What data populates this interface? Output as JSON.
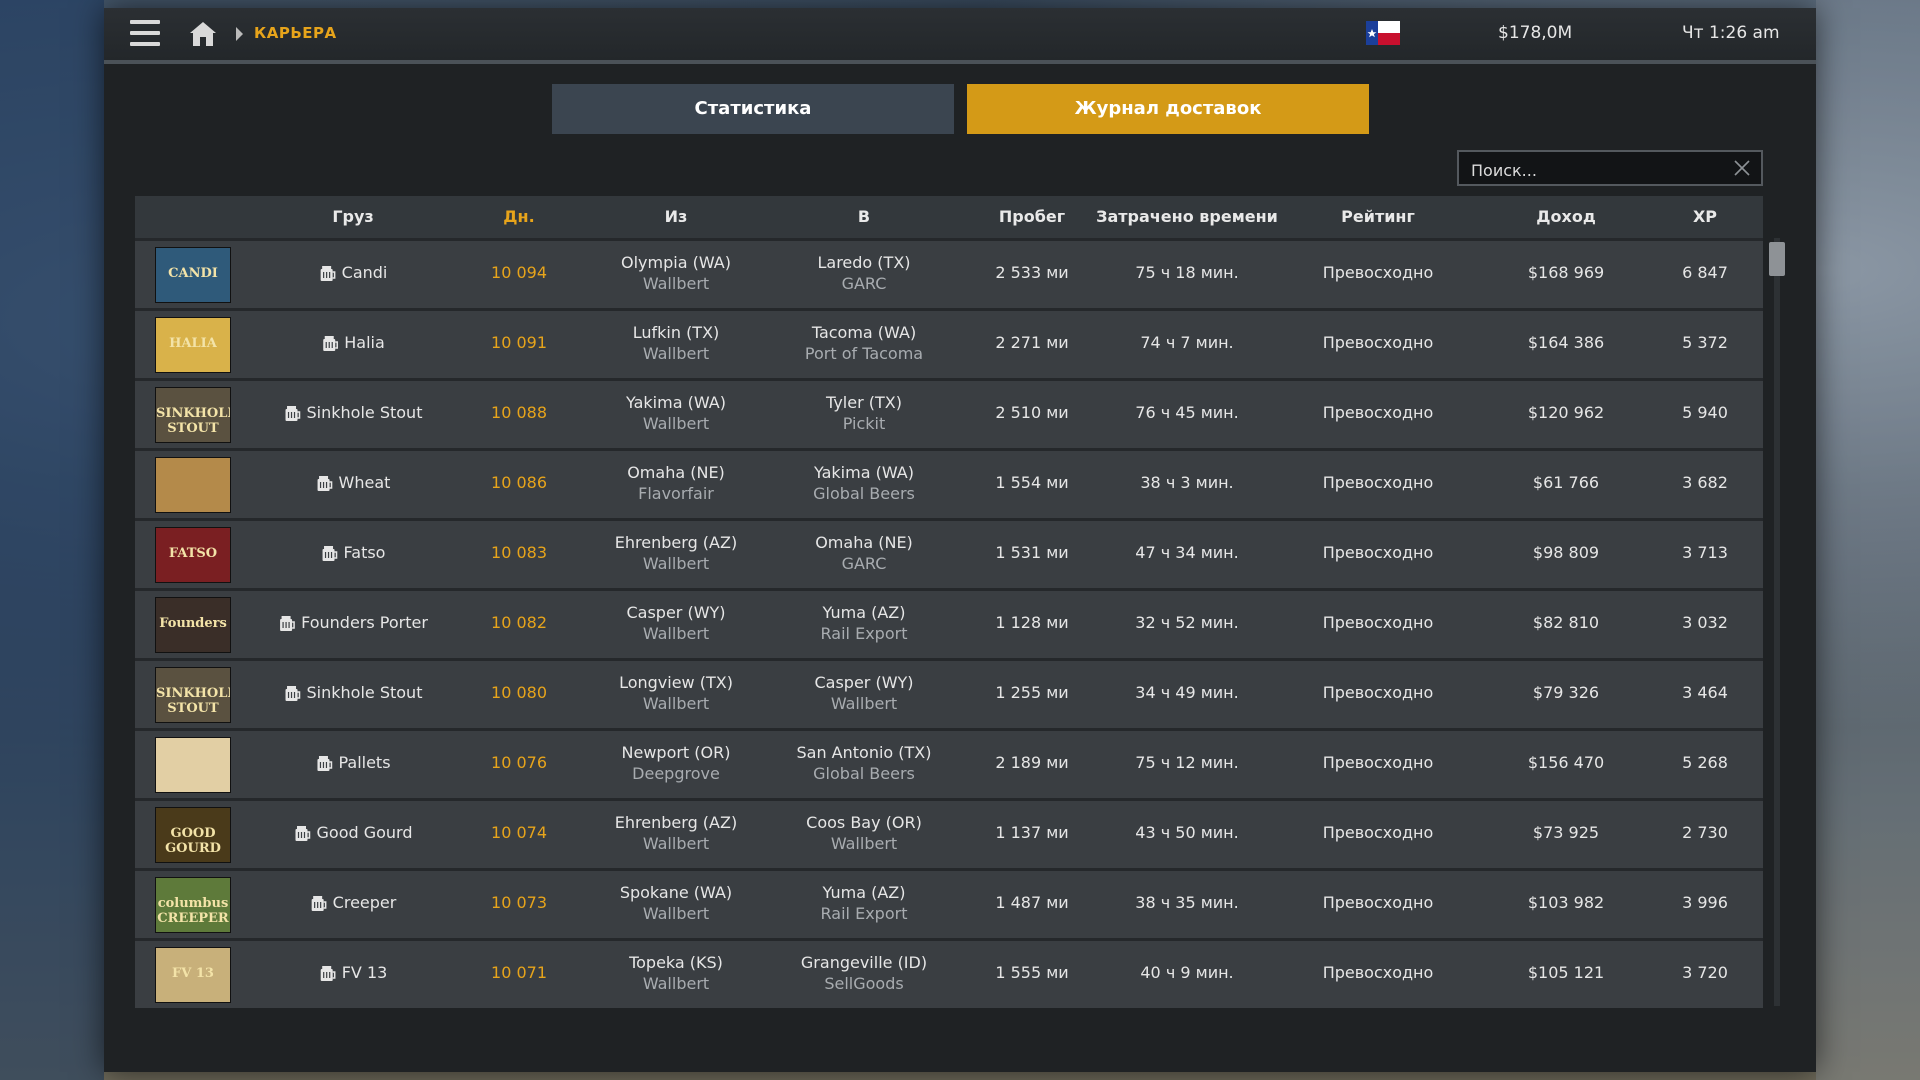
{
  "topbar": {
    "breadcrumb": "КАРЬЕРА",
    "money": "$178,0M",
    "time": "Чт 1:26 am"
  },
  "tabs": {
    "stats": "Статистика",
    "log": "Журнал доставок"
  },
  "search": {
    "placeholder": "Поиск..."
  },
  "columns": {
    "cargo": "Груз",
    "day": "Дн.",
    "from": "Из",
    "to": "В",
    "distance": "Пробег",
    "time": "Затрачено времени",
    "rating": "Рейтинг",
    "income": "Доход",
    "xp": "XP"
  },
  "rows": [
    {
      "thumb": "CANDI",
      "cargo": "Candi",
      "day": "10 094",
      "from_city": "Olympia (WA)",
      "from_company": "Wallbert",
      "to_city": "Laredo (TX)",
      "to_company": "GARC",
      "distance": "2 533 ми",
      "time": "75 ч 18 мин.",
      "rating": "Превосходно",
      "income": "$168 969",
      "xp": "6 847"
    },
    {
      "thumb": "HALIA",
      "cargo": "Halia",
      "day": "10 091",
      "from_city": "Lufkin (TX)",
      "from_company": "Wallbert",
      "to_city": "Tacoma (WA)",
      "to_company": "Port of Tacoma",
      "distance": "2 271 ми",
      "time": "74 ч 7 мин.",
      "rating": "Превосходно",
      "income": "$164 386",
      "xp": "5 372"
    },
    {
      "thumb": "SINKHOLE STOUT",
      "cargo": "Sinkhole Stout",
      "day": "10 088",
      "from_city": "Yakima (WA)",
      "from_company": "Wallbert",
      "to_city": "Tyler (TX)",
      "to_company": "Pickit",
      "distance": "2 510 ми",
      "time": "76 ч 45 мин.",
      "rating": "Превосходно",
      "income": "$120 962",
      "xp": "5 940"
    },
    {
      "thumb": "",
      "cargo": "Wheat",
      "day": "10 086",
      "from_city": "Omaha (NE)",
      "from_company": "Flavorfair",
      "to_city": "Yakima (WA)",
      "to_company": "Global Beers",
      "distance": "1 554 ми",
      "time": "38 ч 3 мин.",
      "rating": "Превосходно",
      "income": "$61 766",
      "xp": "3 682"
    },
    {
      "thumb": "FATSO",
      "cargo": "Fatso",
      "day": "10 083",
      "from_city": "Ehrenberg (AZ)",
      "from_company": "Wallbert",
      "to_city": "Omaha (NE)",
      "to_company": "GARC",
      "distance": "1 531 ми",
      "time": "47 ч 34 мин.",
      "rating": "Превосходно",
      "income": "$98 809",
      "xp": "3 713"
    },
    {
      "thumb": "Founders",
      "cargo": "Founders Porter",
      "day": "10 082",
      "from_city": "Casper (WY)",
      "from_company": "Wallbert",
      "to_city": "Yuma (AZ)",
      "to_company": "Rail Export",
      "distance": "1 128 ми",
      "time": "32 ч 52 мин.",
      "rating": "Превосходно",
      "income": "$82 810",
      "xp": "3 032"
    },
    {
      "thumb": "SINKHOLE STOUT",
      "cargo": "Sinkhole Stout",
      "day": "10 080",
      "from_city": "Longview (TX)",
      "from_company": "Wallbert",
      "to_city": "Casper (WY)",
      "to_company": "Wallbert",
      "distance": "1 255 ми",
      "time": "34 ч 49 мин.",
      "rating": "Превосходно",
      "income": "$79 326",
      "xp": "3 464"
    },
    {
      "thumb": "",
      "cargo": "Pallets",
      "day": "10 076",
      "from_city": "Newport (OR)",
      "from_company": "Deepgrove",
      "to_city": "San Antonio (TX)",
      "to_company": "Global Beers",
      "distance": "2 189 ми",
      "time": "75 ч 12 мин.",
      "rating": "Превосходно",
      "income": "$156 470",
      "xp": "5 268"
    },
    {
      "thumb": "GOOD GOURD",
      "cargo": "Good Gourd",
      "day": "10 074",
      "from_city": "Ehrenberg (AZ)",
      "from_company": "Wallbert",
      "to_city": "Coos Bay (OR)",
      "to_company": "Wallbert",
      "distance": "1 137 ми",
      "time": "43 ч 50 мин.",
      "rating": "Превосходно",
      "income": "$73 925",
      "xp": "2 730"
    },
    {
      "thumb": "columbus CREEPER",
      "cargo": "Creeper",
      "day": "10 073",
      "from_city": "Spokane (WA)",
      "from_company": "Wallbert",
      "to_city": "Yuma (AZ)",
      "to_company": "Rail Export",
      "distance": "1 487 ми",
      "time": "38 ч 35 мин.",
      "rating": "Превосходно",
      "income": "$103 982",
      "xp": "3 996"
    },
    {
      "thumb": "FV 13",
      "cargo": "FV 13",
      "day": "10 071",
      "from_city": "Topeka (KS)",
      "from_company": "Wallbert",
      "to_city": "Grangeville (ID)",
      "to_company": "SellGoods",
      "distance": "1 555 ми",
      "time": "40 ч 9 мин.",
      "rating": "Превосходно",
      "income": "$105 121",
      "xp": "3 720"
    }
  ],
  "thumb_colors": [
    "#2f5a7a",
    "#d9b24a",
    "#5a5140",
    "#b48a4a",
    "#7a1f22",
    "#3a2e28",
    "#5a5140",
    "#e2cfa4",
    "#4a3a1a",
    "#5e7a3a",
    "#c8b07a"
  ],
  "icons": {
    "menu": "hamburger-icon",
    "home": "home-icon",
    "flag": "texas-flag-icon",
    "close": "close-icon",
    "cargo": "cargo-icon"
  },
  "colors": {
    "accent": "#e7a41b",
    "tab_active": "#d49a17",
    "tab_inactive": "#3b4550"
  }
}
